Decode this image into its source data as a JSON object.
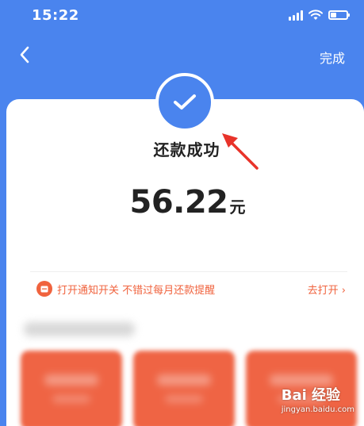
{
  "status_bar": {
    "time": "15:22"
  },
  "nav": {
    "done_label": "完成"
  },
  "result": {
    "title": "还款成功",
    "amount": "56.22",
    "unit": "元"
  },
  "notice": {
    "text": "打开通知开关 不错过每月还款提醒",
    "action": "去打开 ›"
  },
  "watermark": {
    "logo": "Bai 经验",
    "url": "jingyan.baidu.com"
  },
  "colors": {
    "brand_blue": "#4a84ee",
    "notice_orange": "#f0633e",
    "annotation_red": "#e8332a"
  }
}
